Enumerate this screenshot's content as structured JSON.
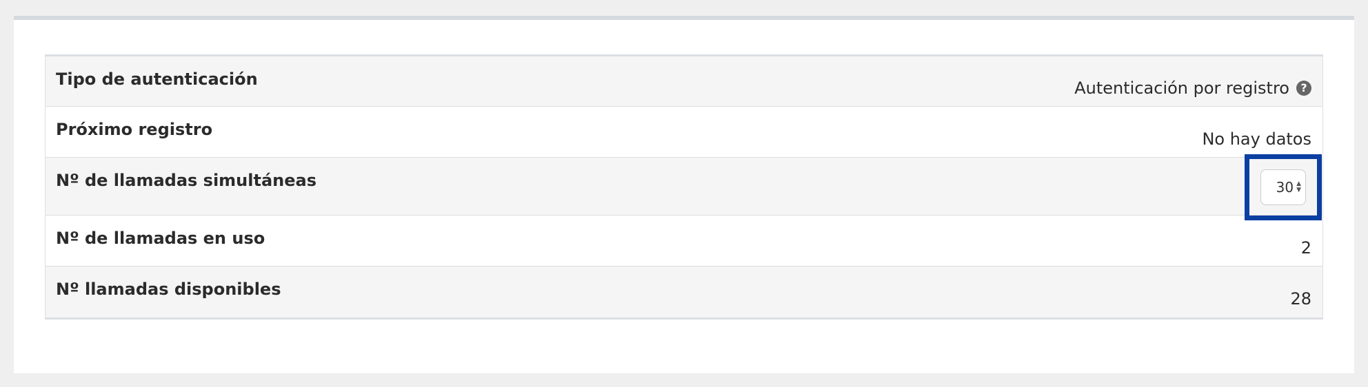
{
  "rows": [
    {
      "label": "Tipo de autenticación",
      "value": "Autenticación por registro",
      "help_icon": "question-circle-icon"
    },
    {
      "label": "Próximo registro",
      "value": "No hay datos"
    },
    {
      "label": "Nº de llamadas simultáneas",
      "stepper_value": "30"
    },
    {
      "label": "Nº de llamadas en uso",
      "value": "2"
    },
    {
      "label": "Nº llamadas disponibles",
      "value": "28"
    }
  ],
  "icons": {
    "help": "question-circle-icon",
    "help_glyph": "?",
    "stepper_up": "▲",
    "stepper_down": "▼"
  },
  "colors": {
    "highlight_border": "#0b3fa1",
    "shaded_row": "#f5f5f5"
  }
}
